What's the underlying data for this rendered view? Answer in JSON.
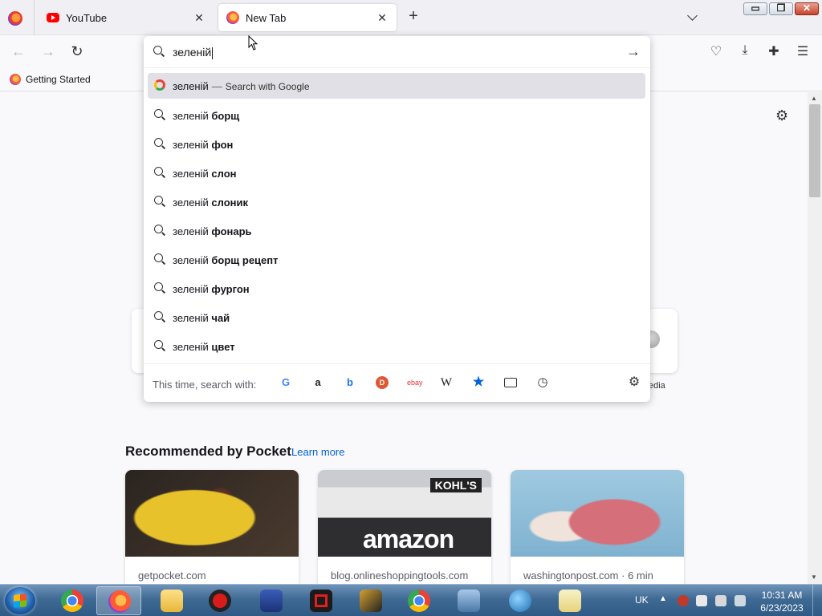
{
  "tabs": [
    {
      "title": "YouTube",
      "active": false,
      "icon": "youtube-icon"
    },
    {
      "title": "New Tab",
      "active": true,
      "icon": "firefox-icon"
    }
  ],
  "window_controls": {
    "minimize": "▭",
    "maximize": "❐",
    "close": "✕"
  },
  "bookmarks": [
    {
      "label": "Getting Started",
      "icon": "firefox-icon"
    }
  ],
  "urlbar": {
    "value": "зеленій"
  },
  "suggestions": {
    "heuristic": {
      "query": "зеленій",
      "separator": "—",
      "action": "Search with Google",
      "engine_icon": "google-icon"
    },
    "items": [
      {
        "prefix": "зеленій",
        "completion": "борщ"
      },
      {
        "prefix": "зеленій",
        "completion": "фон"
      },
      {
        "prefix": "зеленій",
        "completion": "слон"
      },
      {
        "prefix": "зеленій",
        "completion": "слоник"
      },
      {
        "prefix": "зеленій",
        "completion": "фонарь"
      },
      {
        "prefix": "зеленій",
        "completion": "борщ рецепт"
      },
      {
        "prefix": "зеленій",
        "completion": "фургон"
      },
      {
        "prefix": "зеленій",
        "completion": "чай"
      },
      {
        "prefix": "зеленій",
        "completion": "цвет"
      }
    ]
  },
  "one_off": {
    "label": "This time, search with:",
    "engines": [
      {
        "name": "google-icon",
        "glyph": "G"
      },
      {
        "name": "amazon-icon",
        "glyph": "a"
      },
      {
        "name": "bing-icon",
        "glyph": "b"
      },
      {
        "name": "duckduckgo-icon",
        "glyph": "D"
      },
      {
        "name": "ebay-icon",
        "glyph": "ebay"
      },
      {
        "name": "wikipedia-icon",
        "glyph": "W"
      },
      {
        "name": "bookmarks-star-icon",
        "glyph": "★"
      },
      {
        "name": "tabs-icon",
        "glyph": ""
      },
      {
        "name": "history-icon",
        "glyph": "◷"
      }
    ]
  },
  "newtab": {
    "shortcut_label_partial": "edia",
    "pocket_heading": "Recommended by Pocket",
    "learn_more": "Learn more",
    "cards": [
      {
        "source": "getpocket.com",
        "image": "food-photo"
      },
      {
        "source": "blog.onlineshoppingtools.com",
        "image": "amazon-store-photo",
        "overlay_top": "KOHL'S",
        "overlay_main": "amazon"
      },
      {
        "source": "washingtonpost.com · 6 min",
        "image": "raw-meat-photo"
      }
    ]
  },
  "taskbar": {
    "lang": "UK",
    "time": "10:31 AM",
    "date": "6/23/2023"
  },
  "colors": {
    "accent": "#0061e0",
    "selected_row": "#e0e0e6",
    "taskbar": "#3f6a94"
  }
}
